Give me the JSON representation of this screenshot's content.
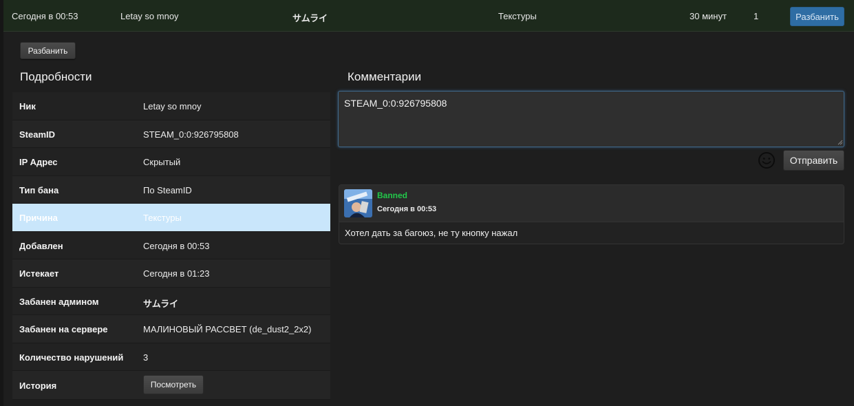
{
  "ban_row": {
    "date": "Сегодня в 00:53",
    "nick": "Letay so mnoy",
    "admin": "サムライ",
    "reason": "Текстуры",
    "length": "30 минут",
    "count": "1",
    "unban_label": "Разбанить"
  },
  "unban_label": "Разбанить",
  "details": {
    "title": "Подробности",
    "rows": [
      {
        "label": "Ник",
        "value": "Letay so mnoy"
      },
      {
        "label": "SteamID",
        "value": "STEAM_0:0:926795808"
      },
      {
        "label": "IP Адрес",
        "value": "Скрытый"
      },
      {
        "label": "Тип бана",
        "value": "По SteamID"
      },
      {
        "label": "Причина",
        "value": "Текстуры"
      },
      {
        "label": "Добавлен",
        "value": "Сегодня в 00:53"
      },
      {
        "label": "Истекает",
        "value": "Сегодня в 01:23"
      },
      {
        "label": "Забанен админом",
        "value": "サムライ"
      },
      {
        "label": "Забанен на сервере",
        "value": "МАЛИНОВЫЙ РАССВЕТ (de_dust2_2x2)"
      },
      {
        "label": "Количество нарушений",
        "value": "3"
      },
      {
        "label": "История",
        "button": "Посмотреть"
      }
    ]
  },
  "comments": {
    "title": "Комментарии",
    "input_value": "STEAM_0:0:926795808",
    "send_label": "Отправить",
    "smile_icon": "smiley-icon",
    "items": [
      {
        "author": "Banned",
        "time": "Сегодня в 00:53",
        "text": "Хотел дать за багоюз, не ту кнопку нажал"
      }
    ]
  },
  "colors": {
    "accent_blue": "#2e6da4",
    "highlight_row": "#c9e6fb",
    "author_green": "#22c84a"
  }
}
